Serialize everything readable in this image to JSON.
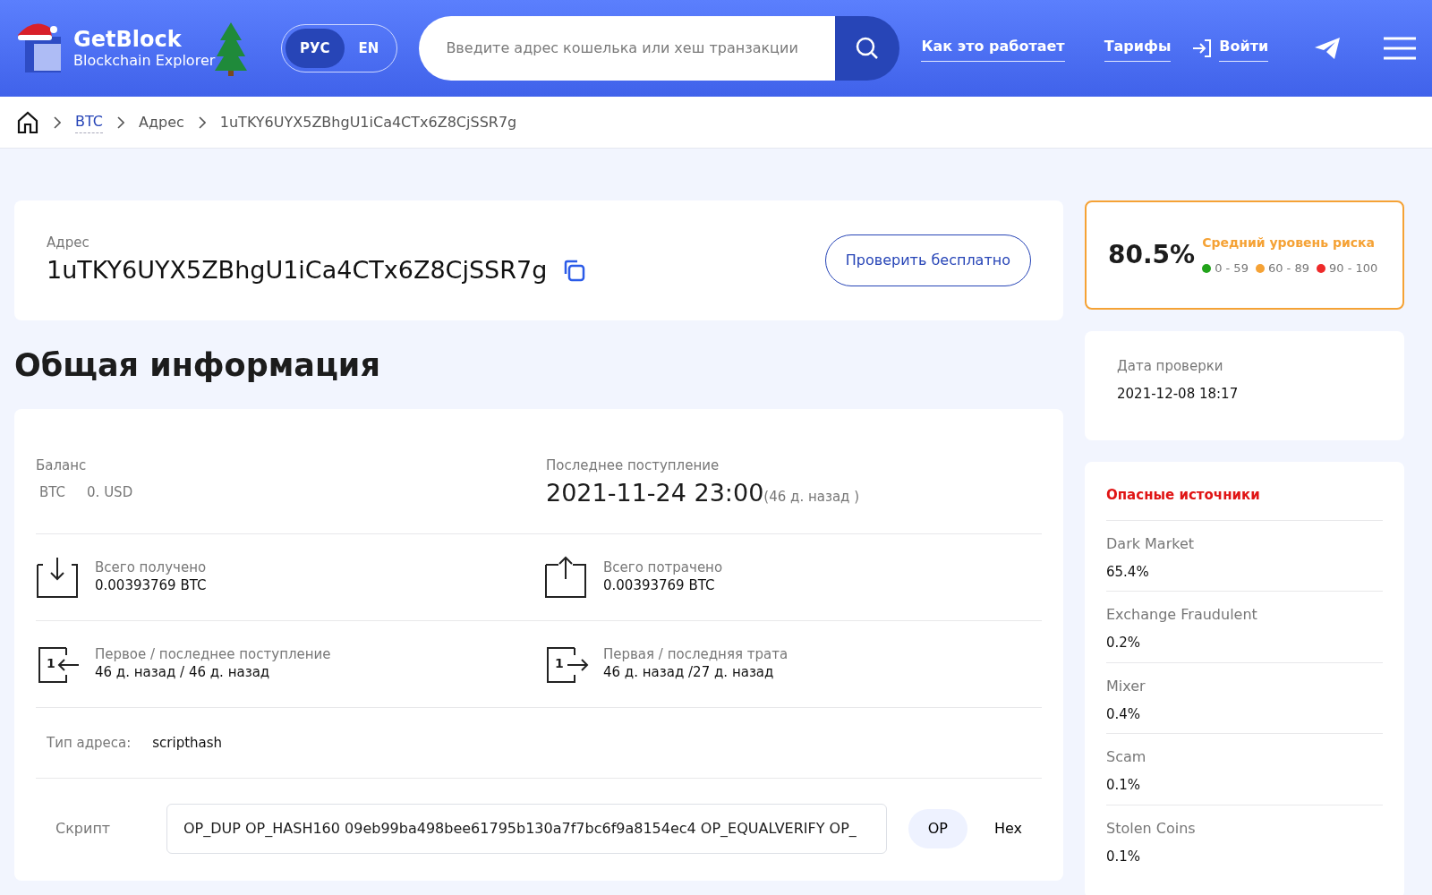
{
  "header": {
    "logo": {
      "title": "GetBlock",
      "subtitle": "Blockchain Explorer"
    },
    "languages": [
      {
        "label": "РУС",
        "selected": true
      },
      {
        "label": "EN",
        "selected": false
      }
    ],
    "search": {
      "placeholder": "Введите адрес кошелька или хеш транзакции"
    },
    "nav": [
      {
        "label": "Как это работает",
        "kind": "link"
      },
      {
        "label": "Тарифы",
        "kind": "link"
      },
      {
        "label": "Войти",
        "kind": "login"
      }
    ]
  },
  "breadcrumb": [
    {
      "label": "BTC",
      "kind": "link"
    },
    {
      "label": "Адрес",
      "kind": "text"
    },
    {
      "label": "1uTKY6UYX5ZBhgU1iCa4CTx6Z8CjSSR7g",
      "kind": "text"
    }
  ],
  "address_card": {
    "label": "Адрес",
    "address": "1uTKY6UYX5ZBhgU1iCa4CTx6Z8CjSSR7g",
    "button": "Проверить бесплатно"
  },
  "section_title": "Общая информация",
  "info": {
    "balance": {
      "label": "Баланс",
      "currency": "BTC",
      "value": "0. USD"
    },
    "last_receipt": {
      "label": "Последнее поступление",
      "date": "2021-11-24 23:00",
      "ago": "(46 д. назад )"
    },
    "stats": [
      {
        "kind": "in",
        "label": "Всего получено",
        "value": "0.00393769 BTC"
      },
      {
        "kind": "out",
        "label": "Всего потрачено",
        "value": "0.00393769 BTC"
      },
      {
        "kind": "first-in",
        "digit": "1",
        "label": "Первое / последнее поступление",
        "value": "46 д. назад / 46 д. назад"
      },
      {
        "kind": "first-out",
        "digit": "1",
        "label": "Первая / последняя трата",
        "value": "46 д. назад /27 д. назад"
      }
    ],
    "address_type": {
      "label": "Тип адреса:",
      "value": "scripthash"
    },
    "script": {
      "label": "Скрипт",
      "value": "OP_DUP OP_HASH160 09eb99ba498bee61795b130a7f7bc6f9a8154ec4 OP_EQUALVERIFY OP_",
      "modes": [
        {
          "label": "OP",
          "selected": true
        },
        {
          "label": "Hex",
          "selected": false
        }
      ]
    }
  },
  "risk": {
    "score": "80.5%",
    "level_label": "Средний уровень риска",
    "color": "#f5a235",
    "legend": [
      {
        "label": "0 - 59",
        "color": "#22a31b"
      },
      {
        "label": "60 - 89",
        "color": "#f5a235"
      },
      {
        "label": "90 - 100",
        "color": "#ee2a2a"
      }
    ]
  },
  "check_date": {
    "label": "Дата проверки",
    "value": "2021-12-08 18:17"
  },
  "sources": {
    "title": "Опасные источники",
    "items": [
      {
        "name": "Dark Market",
        "value": "65.4%"
      },
      {
        "name": "Exchange Fraudulent",
        "value": "0.2%"
      },
      {
        "name": "Mixer",
        "value": "0.4%"
      },
      {
        "name": "Scam",
        "value": "0.1%"
      },
      {
        "name": "Stolen Coins",
        "value": "0.1%"
      }
    ]
  }
}
